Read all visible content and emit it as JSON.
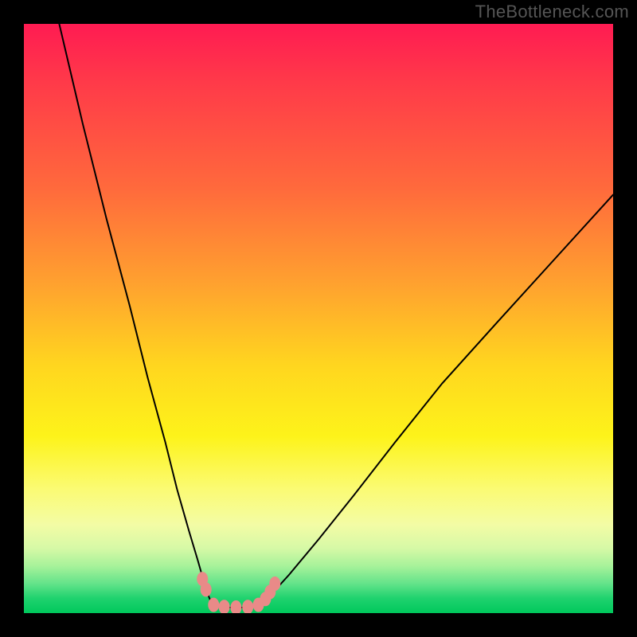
{
  "watermark": "TheBottleneck.com",
  "chart_data": {
    "type": "line",
    "title": "",
    "xlabel": "",
    "ylabel": "",
    "xlim": [
      0,
      100
    ],
    "ylim": [
      0,
      100
    ],
    "grid": false,
    "legend": false,
    "notes": "V-shaped bottleneck curve over a red-to-green gradient background. Axis ticks and labels are not drawn in the source image; x/y values are normalized 0–100 estimates read from pixel positions.",
    "series": [
      {
        "name": "left-branch",
        "x": [
          6,
          10,
          14,
          18,
          21,
          24,
          26,
          28,
          29.5,
          30.5,
          31.3,
          32
        ],
        "values": [
          100,
          83,
          67,
          52,
          40,
          29,
          21,
          14,
          9,
          5.5,
          3,
          1.3
        ]
      },
      {
        "name": "floor",
        "x": [
          32,
          34,
          36,
          38,
          40
        ],
        "values": [
          1.3,
          1.0,
          0.9,
          1.0,
          1.3
        ]
      },
      {
        "name": "right-branch",
        "x": [
          40,
          42,
          45,
          50,
          56,
          63,
          71,
          80,
          90,
          100
        ],
        "values": [
          1.3,
          3.2,
          6.5,
          12.5,
          20,
          29,
          39,
          49,
          60,
          71
        ]
      }
    ],
    "markers": {
      "name": "highlight-dots",
      "color": "#e98a88",
      "x": [
        30.3,
        30.9,
        32.2,
        34.0,
        36.0,
        38.0,
        39.8,
        41.0,
        41.8,
        42.6
      ],
      "values": [
        5.8,
        4.0,
        1.4,
        1.05,
        0.95,
        1.05,
        1.4,
        2.4,
        3.6,
        5.0
      ]
    },
    "background_gradient": {
      "direction": "top-to-bottom",
      "stops": [
        {
          "pos": 0.0,
          "color": "#ff1b52"
        },
        {
          "pos": 0.28,
          "color": "#ff6a3c"
        },
        {
          "pos": 0.58,
          "color": "#ffd61f"
        },
        {
          "pos": 0.79,
          "color": "#fbfb74"
        },
        {
          "pos": 0.92,
          "color": "#a7f29a"
        },
        {
          "pos": 1.0,
          "color": "#00c85c"
        }
      ]
    }
  }
}
